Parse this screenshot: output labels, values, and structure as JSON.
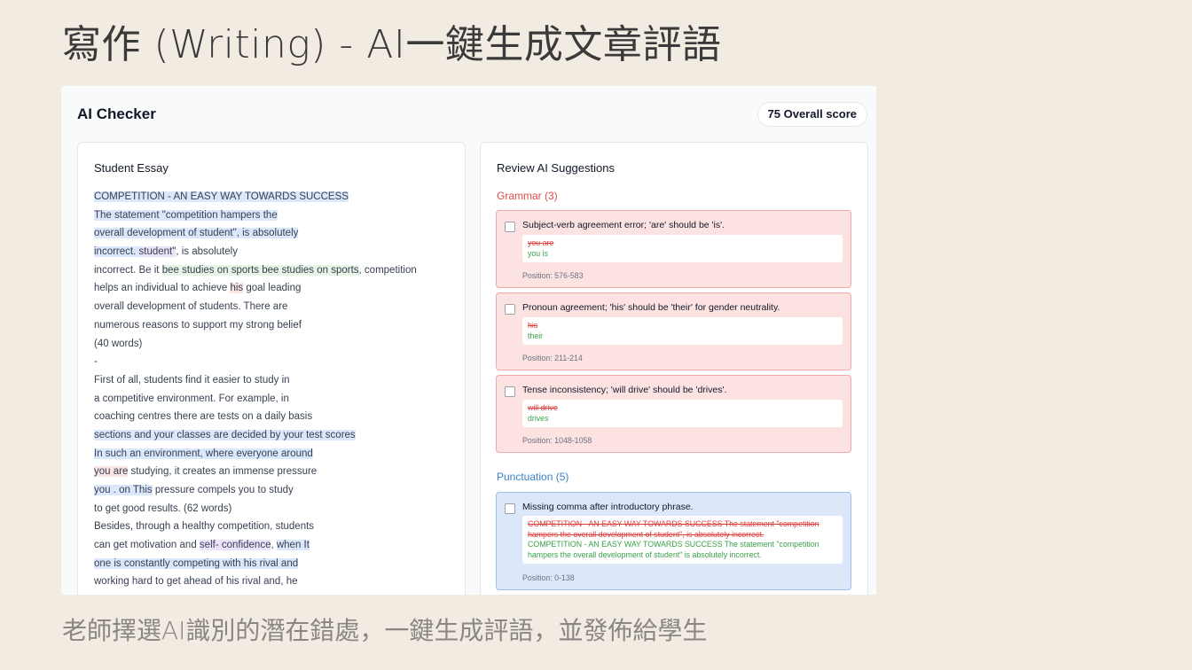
{
  "slide": {
    "title": "寫作 (Writing)  - AI一鍵生成文章評語",
    "caption": "老師擇選AI識別的潛在錯處，一鍵生成評語，並發佈給學生"
  },
  "app": {
    "title": "AI Checker",
    "score": "75 Overall score"
  },
  "essay": {
    "title": "Student Essay",
    "lines": [
      [
        {
          "t": "COMPETITION - AN EASY WAY TOWARDS SUCCESS",
          "h": "blue"
        }
      ],
      [
        {
          "t": "The statement \"competition hampers the",
          "h": "blue"
        }
      ],
      [
        {
          "t": "overall development of student\", is absolutely",
          "h": "blue"
        }
      ],
      [
        {
          "t": "incorrect. ",
          "h": "blue"
        },
        {
          "t": "student\"",
          "h": "purple"
        },
        {
          "t": ", is absolutely",
          "h": ""
        }
      ],
      [
        {
          "t": "incorrect. Be it ",
          "h": ""
        },
        {
          "t": "bee studies on sports bee studies on sports",
          "h": "green"
        },
        {
          "t": ", competition",
          "h": ""
        }
      ],
      [
        {
          "t": "helps an individual to achieve ",
          "h": ""
        },
        {
          "t": "his",
          "h": "red"
        },
        {
          "t": " goal leading",
          "h": ""
        }
      ],
      [
        {
          "t": "overall development of students. There are",
          "h": ""
        }
      ],
      [
        {
          "t": "numerous reasons to support my strong belief",
          "h": ""
        }
      ],
      [
        {
          "t": "(40 words)",
          "h": ""
        }
      ],
      [
        {
          "t": "-",
          "h": ""
        }
      ],
      [
        {
          "t": "First of all, students find it easier to study in",
          "h": ""
        }
      ],
      [
        {
          "t": "a competitive environment. For example, in",
          "h": ""
        }
      ],
      [
        {
          "t": "coaching centres there are tests on a daily basis",
          "h": ""
        }
      ],
      [
        {
          "t": "sections and your classes are decided by your test scores",
          "h": "blue"
        }
      ],
      [
        {
          "t": "In such an environment, where everyone around",
          "h": "blue"
        }
      ],
      [
        {
          "t": "you are",
          "h": "red"
        },
        {
          "t": " studying, it creates an immense pressure",
          "h": ""
        }
      ],
      [
        {
          "t": "you . on This",
          "h": "blue"
        },
        {
          "t": " pressure compels you to study",
          "h": ""
        }
      ],
      [
        {
          "t": "to get good results. (62 words)",
          "h": ""
        }
      ],
      [
        {
          "t": "Besides, through a healthy competition, students",
          "h": ""
        }
      ],
      [
        {
          "t": "can get motivation and ",
          "h": ""
        },
        {
          "t": "self- confidence",
          "h": "purple"
        },
        {
          "t": ", ",
          "h": ""
        },
        {
          "t": "when It",
          "h": "blue"
        }
      ],
      [
        {
          "t": "one is constantly competing with his rival and",
          "h": "blue"
        }
      ],
      [
        {
          "t": "working hard to get ahead of his rival and, he",
          "h": ""
        }
      ]
    ]
  },
  "suggestions": {
    "title": "Review AI Suggestions",
    "grammar_title": "Grammar (3)",
    "punctuation_title": "Punctuation (5)",
    "grammar": [
      {
        "message": "Subject-verb agreement error; 'are' should be 'is'.",
        "old": "you are",
        "new": "you is",
        "position": "Position: 576-583"
      },
      {
        "message": "Pronoun agreement; 'his' should be 'their' for gender neutrality.",
        "old": "his",
        "new": "their",
        "position": "Position: 211-214"
      },
      {
        "message": "Tense inconsistency; 'will drive' should be 'drives'.",
        "old": "will drive",
        "new": "drives",
        "position": "Position: 1048-1058"
      }
    ],
    "punctuation": [
      {
        "message": "Missing comma after introductory phrase.",
        "old": "COMPETITION - AN EASY WAY TOWARDS SUCCESS The statement \"competition hampers the overall development of student\", is absolutely incorrect.",
        "new": "COMPETITION - AN EASY WAY TOWARDS SUCCESS The statement \"competition hampers the overall development of student\" is absolutely incorrect.",
        "position": "Position: 0-138"
      }
    ]
  },
  "colors": {
    "background": "#f2ebe1",
    "grammar_accent": "#dc4c4c",
    "punctuation_accent": "#3b82c4"
  }
}
